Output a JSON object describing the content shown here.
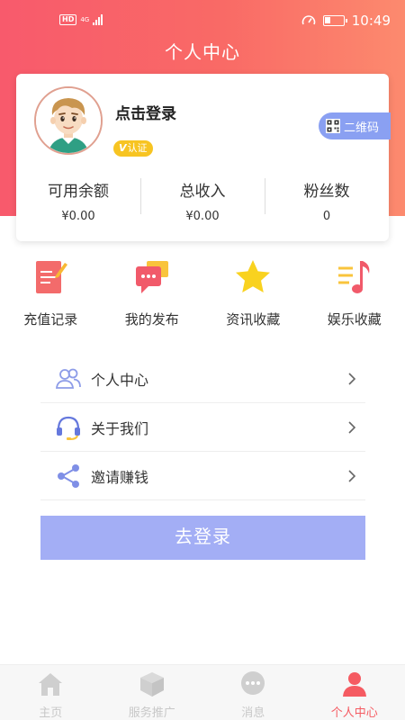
{
  "status_bar": {
    "hd": "HD",
    "network": "4G",
    "time": "10:49"
  },
  "header": {
    "title": "个人中心"
  },
  "profile": {
    "login_prompt": "点击登录",
    "verify_mark": "V",
    "verify_label": "认证",
    "qr_label": "二维码"
  },
  "stats": [
    {
      "label": "可用余额",
      "value": "¥0.00"
    },
    {
      "label": "总收入",
      "value": "¥0.00"
    },
    {
      "label": "粉丝数",
      "value": "0"
    }
  ],
  "quick_actions": [
    {
      "label": "充值记录",
      "icon": "recharge-record-icon"
    },
    {
      "label": "我的发布",
      "icon": "my-posts-icon"
    },
    {
      "label": "资讯收藏",
      "icon": "star-icon"
    },
    {
      "label": "娱乐收藏",
      "icon": "music-note-icon"
    }
  ],
  "menu": [
    {
      "label": "个人中心",
      "icon": "users-icon"
    },
    {
      "label": "关于我们",
      "icon": "headset-icon"
    },
    {
      "label": "邀请赚钱",
      "icon": "share-icon"
    }
  ],
  "login_button": "去登录",
  "tabs": [
    {
      "label": "主页",
      "icon": "home-icon"
    },
    {
      "label": "服务推广",
      "icon": "cube-icon"
    },
    {
      "label": "消息",
      "icon": "chat-icon"
    },
    {
      "label": "个人中心",
      "icon": "person-icon",
      "active": true
    }
  ],
  "colors": {
    "header_start": "#f85a6c",
    "header_end": "#fc8a6e",
    "accent": "#f55b62",
    "button": "#a3aef5",
    "qr_tab": "#8aa0f2",
    "badge": "#f7c422"
  }
}
